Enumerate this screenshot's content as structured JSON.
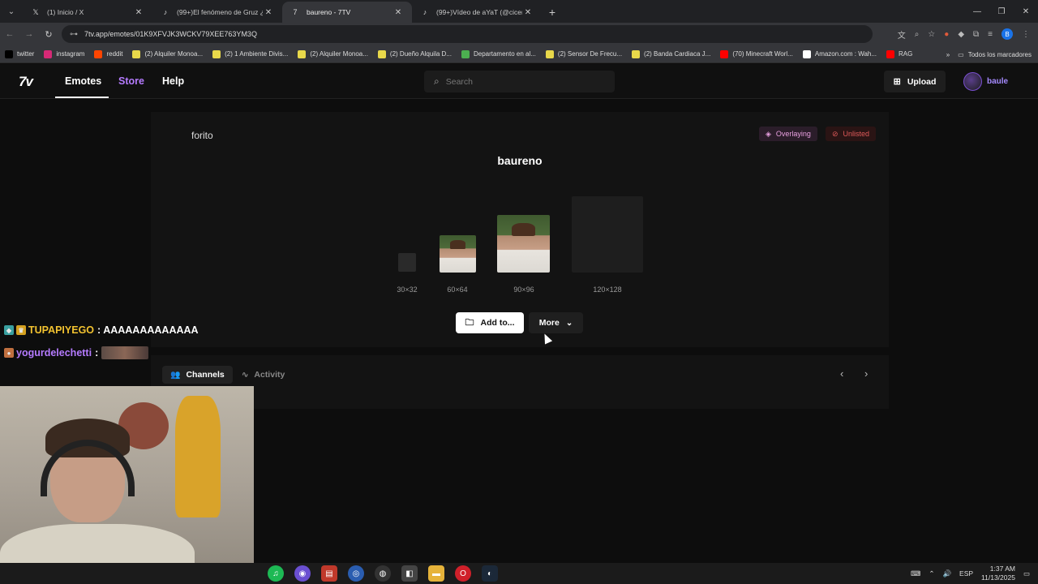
{
  "browser": {
    "tabs": [
      {
        "label": "(1) Inicio / X",
        "icon": "x-logo-icon",
        "active": false
      },
      {
        "label": "(99+)El fenómeno de Gruz ¿Se l",
        "icon": "tiktok-icon",
        "active": false
      },
      {
        "label": "baureno - 7TV",
        "icon": "7tv-icon",
        "active": true
      },
      {
        "label": "(99+)Vídeo de aYaT (@cicem.u",
        "icon": "tiktok-icon",
        "active": false
      }
    ],
    "url": "7tv.app/emotes/01K9XFVJK3WCKV79XEE763YM3Q",
    "bookmarks": [
      {
        "label": "twitter",
        "color": "#000000"
      },
      {
        "label": "instagram",
        "color": "#d62976"
      },
      {
        "label": "reddit",
        "color": "#ff4500"
      },
      {
        "label": "(2) Alquiler Monoa...",
        "color": "#e8d84a"
      },
      {
        "label": "(2) 1 Ambiente Divis...",
        "color": "#e8d84a"
      },
      {
        "label": "(2) Alquiler Monoa...",
        "color": "#e8d84a"
      },
      {
        "label": "(2) Dueño Alquila D...",
        "color": "#e8d84a"
      },
      {
        "label": "Departamento en al...",
        "color": "#4caf50"
      },
      {
        "label": "(2) Sensor De Frecu...",
        "color": "#e8d84a"
      },
      {
        "label": "(2) Banda Cardiaca J...",
        "color": "#e8d84a"
      },
      {
        "label": "(70) Minecraft Worl...",
        "color": "#ff0000"
      },
      {
        "label": "Amazon.com : Wah...",
        "color": "#ffffff"
      },
      {
        "label": "RAG",
        "color": "#ff0000"
      }
    ],
    "all_bookmarks": "Todos los marcadores"
  },
  "site": {
    "logo": "7v",
    "nav": {
      "emotes": "Emotes",
      "store": "Store",
      "help": "Help"
    },
    "search_placeholder": "Search",
    "upload": "Upload",
    "username": "baule"
  },
  "emote": {
    "owner": "forito",
    "name": "baureno",
    "tags": {
      "overlaying": "Overlaying",
      "unlisted": "Unlisted"
    },
    "sizes": [
      "30×32",
      "60×64",
      "90×96",
      "120×128"
    ],
    "add_to": "Add to...",
    "more": "More",
    "tabs": {
      "channels": "Channels",
      "activity": "Activity"
    }
  },
  "stream": {
    "chat": [
      {
        "user": "TUPAPIYEGO",
        "message": ": AAAAAAAAAAAAA"
      },
      {
        "user": "yogurdelechetti",
        "message": ":"
      }
    ]
  },
  "taskbar": {
    "lang": "ESP",
    "time": "1:37 AM",
    "date": "11/13/2025"
  }
}
